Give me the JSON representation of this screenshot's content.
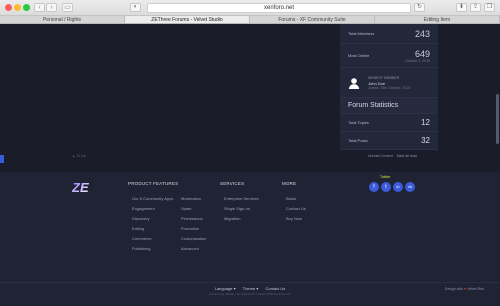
{
  "browser": {
    "address": "xenforo.net",
    "tabs": [
      {
        "label": "Personal / Rights",
        "active": false
      },
      {
        "label": "ZEThree Forums - Velvet Studio",
        "active": true
      },
      {
        "label": "Forums - XF Community Suite",
        "active": false
      },
      {
        "label": "Editing Item",
        "active": false
      }
    ]
  },
  "sidebar": {
    "total_members_label": "Total Members",
    "total_members_value": "243",
    "most_online_label": "Most Online",
    "most_online_value": "649",
    "most_online_date": "October 3, 2016",
    "newest_member_label": "NEWEST MEMBER",
    "newest_member_name": "John Doe",
    "newest_member_date": "Joined: 15th October, 2016",
    "forum_stats_title": "Forum Statistics",
    "total_topics_label": "Total Topics",
    "total_topics_value": "12",
    "total_posts_label": "Total Posts",
    "total_posts_value": "32"
  },
  "page_links": {
    "back_to_top": "▲ To top",
    "mark_read": "Unread Content",
    "mark_all": "Mark all read"
  },
  "footer": {
    "logo_text": "ZE",
    "product_features_title": "PRODUCT FEATURES",
    "features_col1": [
      "Our 8 Community Apps",
      "Engagement",
      "Discovery",
      "Editing",
      "Commerce",
      "Publishing"
    ],
    "features_col2": [
      "Moderation",
      "Spam",
      "Permissions",
      "Promotion",
      "Customization",
      "Advanced"
    ],
    "services_title": "SERVICES",
    "services": [
      "Enterprise Services",
      "Single Sign-on",
      "Migration"
    ],
    "more_title": "MORE",
    "more": [
      "Blank",
      "Contact Us",
      "Buy Now"
    ],
    "social_label": "Twitter",
    "social_icons": [
      "f",
      "t",
      "in",
      "vk"
    ]
  },
  "bottom": {
    "language": "Language ▾",
    "theme": "Theme ▾",
    "contact": "Contact Us",
    "copyright": "Community platform by XenForo® © 2010-2016 XenForo Ltd.",
    "made_with_prefix": "Design with",
    "made_with_suffix": "Velvet Red"
  },
  "colors": {
    "accent": "#3b5bdb",
    "page_bg": "#1a1d29",
    "footer_bg": "#202334"
  }
}
